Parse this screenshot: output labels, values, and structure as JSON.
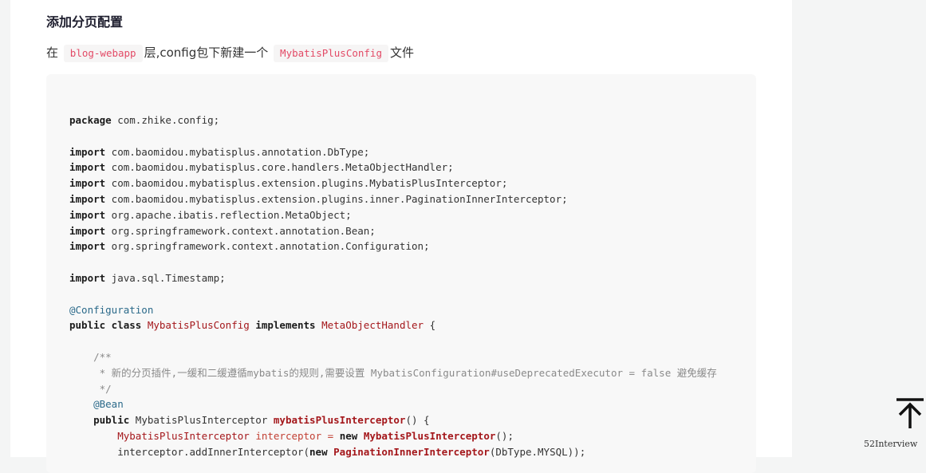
{
  "section": {
    "heading": "添加分页配置",
    "paragraph": {
      "prefix": "在",
      "code1": "blog-webapp",
      "middle": "层,config包下新建一个",
      "code2": "MybatisPlusConfig",
      "suffix": "文件"
    }
  },
  "code_lines": {
    "package_kw": "package",
    "package_name": " com.zhike.config;",
    "import_kw": "import",
    "imports": [
      " com.baomidou.mybatisplus.annotation.DbType;",
      " com.baomidou.mybatisplus.core.handlers.MetaObjectHandler;",
      " com.baomidou.mybatisplus.extension.plugins.MybatisPlusInterceptor;",
      " com.baomidou.mybatisplus.extension.plugins.inner.PaginationInnerInterceptor;",
      " org.apache.ibatis.reflection.MetaObject;",
      " org.springframework.context.annotation.Bean;",
      " org.springframework.context.annotation.Configuration;",
      " java.sql.Timestamp;"
    ],
    "annotation_configuration": "@Configuration",
    "public_class": "public class",
    "class_name": "MybatisPlusConfig",
    "implements": "implements",
    "interface_name": "MetaObjectHandler",
    "brace_open": " {",
    "comment_start": "    /**",
    "comment_body": "     * 新的分页插件,一缓和二缓遵循mybatis的规则,需要设置 MybatisConfiguration#useDeprecatedExecutor = false 避免缓存",
    "comment_end": "     */",
    "annotation_bean": "@Bean",
    "public_kw": "public",
    "return_type": " MybatisPlusInterceptor ",
    "method_name": "mybatisPlusInterceptor",
    "method_tail": "() {",
    "local_type": "MybatisPlusInterceptor",
    "local_var": "interceptor",
    "assign": " = ",
    "new_kw": "new",
    "ctor_name": "MybatisPlusInterceptor",
    "ctor_tail": "();",
    "last_head": "        interceptor.addInnerInterceptor(",
    "last_new": "new",
    "last_ctor": "PaginationInnerInterceptor",
    "last_tail": "(DbType.MYSQL));"
  },
  "back_to_top": {
    "icon": "arrow-up-to-top-icon",
    "caption": "52Interview"
  }
}
